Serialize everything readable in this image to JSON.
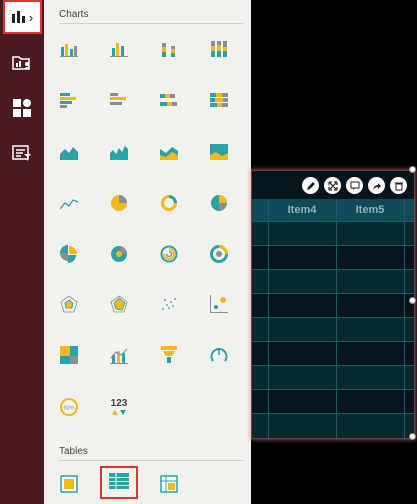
{
  "panel": {
    "charts_title": "Charts",
    "tables_title": "Tables",
    "kpi_label": "123",
    "gauge_label": "60%"
  },
  "grid": {
    "columns": [
      "Item4",
      "Item5"
    ]
  },
  "colors": {
    "rail": "#4a1a20",
    "panel": "#f2f1ee",
    "teal": "#2aa3a8",
    "yellow": "#f3b81b",
    "gray": "#8a8f95",
    "highlight": "#d9362e",
    "grid_header": "#0f4a57"
  }
}
